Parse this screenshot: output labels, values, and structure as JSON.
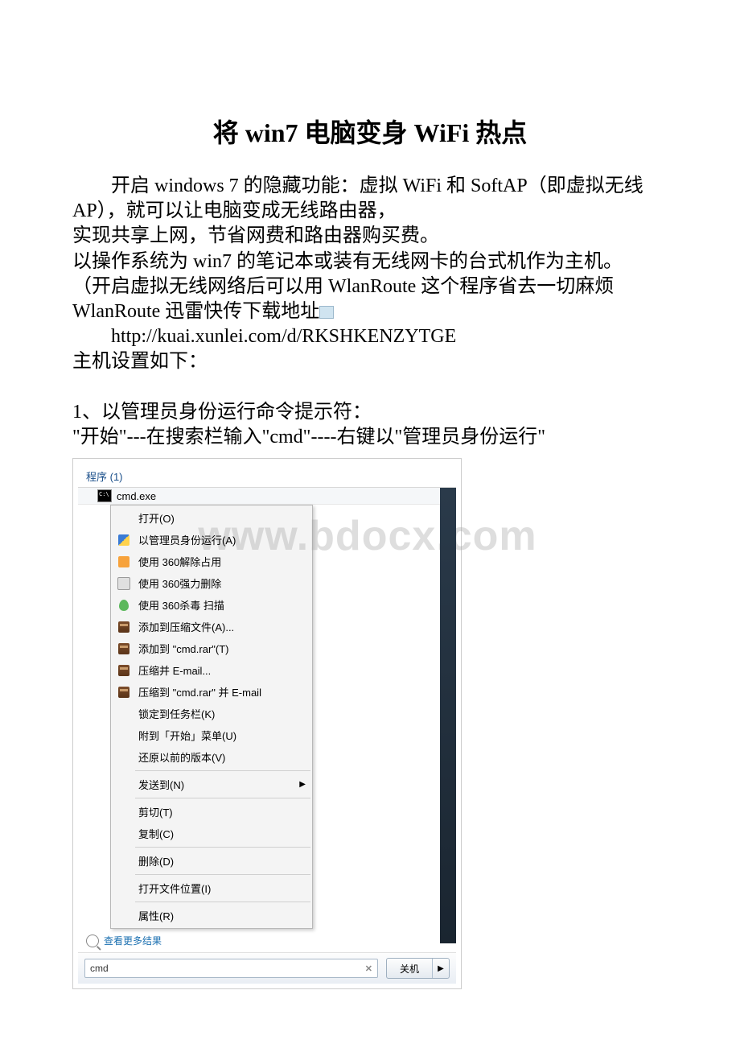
{
  "title": "将 win7 电脑变身 WiFi 热点",
  "paragraphs": {
    "p1": "开启 windows 7 的隐藏功能：虚拟 WiFi 和 SoftAP（即虚拟无线AP），就可以让电脑变成无线路由器，",
    "p2": "实现共享上网，节省网费和路由器购买费。",
    "p3": "以操作系统为 win7 的笔记本或装有无线网卡的台式机作为主机。",
    "p4": "（开启虚拟无线网络后可以用 WlanRoute 这个程序省去一切麻烦  WlanRoute 迅雷快传下载地址",
    "p5": "http://kuai.xunlei.com/d/RKSHKENZYTGE",
    "p6": "主机设置如下：",
    "p7": "1、以管理员身份运行命令提示符：",
    "p8": "\"开始\"---在搜索栏输入\"cmd\"----右键以\"管理员身份运行\""
  },
  "watermark": "www.bdocx.com",
  "screenshot": {
    "section_header": "程序 (1)",
    "result_item": "cmd.exe",
    "context_menu": [
      {
        "label": "打开(O)",
        "icon": ""
      },
      {
        "label": "以管理员身份运行(A)",
        "icon": "shield"
      },
      {
        "label": "使用 360解除占用",
        "icon": "360orange"
      },
      {
        "label": "使用 360强力删除",
        "icon": "360del"
      },
      {
        "label": "使用 360杀毒 扫描",
        "icon": "360green"
      },
      {
        "label": "添加到压缩文件(A)...",
        "icon": "rar"
      },
      {
        "label": "添加到 \"cmd.rar\"(T)",
        "icon": "rar"
      },
      {
        "label": "压缩并 E-mail...",
        "icon": "rar"
      },
      {
        "label": "压缩到 \"cmd.rar\" 并 E-mail",
        "icon": "rar"
      },
      {
        "label": "锁定到任务栏(K)",
        "icon": ""
      },
      {
        "label": "附到「开始」菜单(U)",
        "icon": ""
      },
      {
        "label": "还原以前的版本(V)",
        "icon": ""
      },
      {
        "sep": true
      },
      {
        "label": "发送到(N)",
        "icon": "",
        "submenu": true
      },
      {
        "sep": true
      },
      {
        "label": "剪切(T)",
        "icon": ""
      },
      {
        "label": "复制(C)",
        "icon": ""
      },
      {
        "sep": true
      },
      {
        "label": "删除(D)",
        "icon": ""
      },
      {
        "sep": true
      },
      {
        "label": "打开文件位置(I)",
        "icon": ""
      },
      {
        "sep": true
      },
      {
        "label": "属性(R)",
        "icon": ""
      }
    ],
    "see_more": "查看更多结果",
    "search_value": "cmd",
    "shutdown_label": "关机"
  }
}
